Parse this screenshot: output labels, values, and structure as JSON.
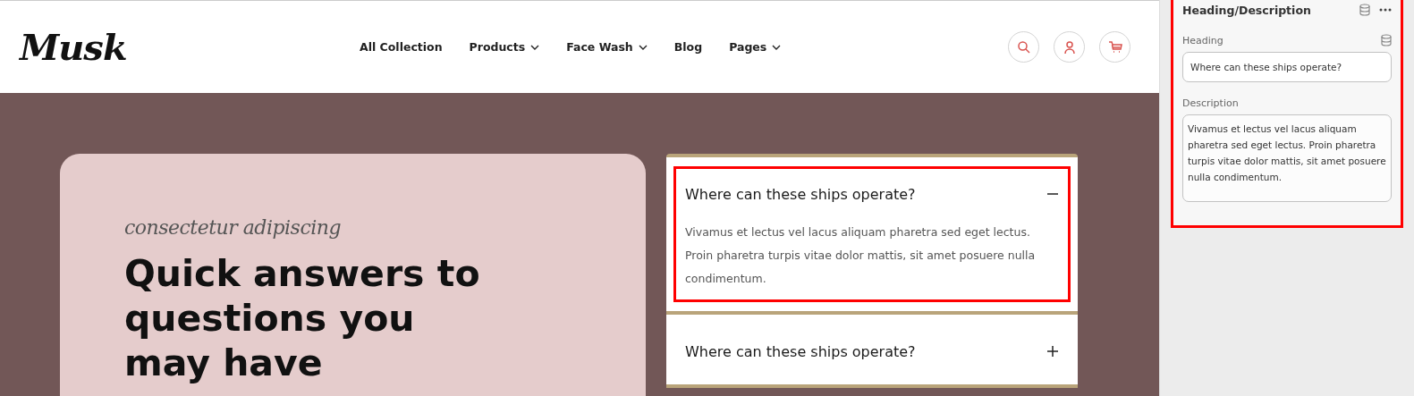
{
  "header": {
    "logo": "Musk",
    "nav": [
      {
        "label": "All Collection",
        "has_menu": false
      },
      {
        "label": "Products",
        "has_menu": true
      },
      {
        "label": "Face Wash",
        "has_menu": true
      },
      {
        "label": "Blog",
        "has_menu": false
      },
      {
        "label": "Pages",
        "has_menu": true
      }
    ]
  },
  "hero": {
    "tagline": "consectetur adipiscing",
    "heading_lines": [
      "Quick answers to",
      "questions you",
      "may have"
    ]
  },
  "faq": {
    "items": [
      {
        "question": "Where can these ships operate?",
        "answer": "Vivamus et lectus vel lacus aliquam pharetra sed eget lectus. Proin pharetra turpis vitae dolor mattis, sit amet posuere nulla condimentum.",
        "expanded": true,
        "selected": true
      },
      {
        "question": "Where can these ships operate?",
        "expanded": false,
        "selected": false
      }
    ]
  },
  "editor_panel": {
    "title": "Heading/Description",
    "selected": true,
    "fields": [
      {
        "label": "Heading",
        "kind": "input",
        "value": "Where can these ships operate?",
        "dynamic": true
      },
      {
        "label": "Description",
        "kind": "textarea",
        "value": "Vivamus et lectus vel lacus aliquam pharetra sed eget lectus. Proin pharetra turpis vitae dolor mattis, sit amet posuere nulla condimentum.",
        "dynamic": false
      }
    ]
  }
}
